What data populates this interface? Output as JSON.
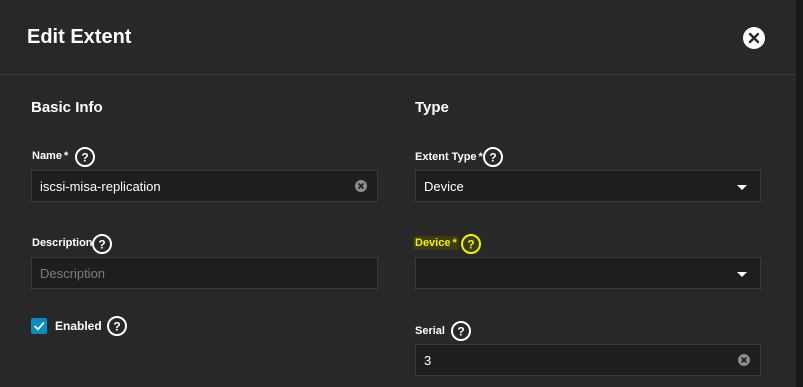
{
  "dialog": {
    "title": "Edit Extent"
  },
  "basic_info": {
    "section_title": "Basic Info",
    "name": {
      "label": "Name",
      "required_mark": "*",
      "value": "iscsi-misa-replication"
    },
    "description": {
      "label": "Description",
      "value": "",
      "placeholder": "Description"
    },
    "enabled": {
      "label": "Enabled",
      "checked": true
    }
  },
  "type": {
    "section_title": "Type",
    "extent_type": {
      "label": "Extent Type",
      "required_mark": "*",
      "value": "Device"
    },
    "device": {
      "label": "Device",
      "required_mark": "*",
      "value": ""
    },
    "serial": {
      "label": "Serial",
      "value": "3"
    }
  },
  "colors": {
    "panel_bg": "#282828",
    "input_bg": "#1e1e1e",
    "accent_checkbox": "#0a8bc4",
    "highlight_text": "#f2f200"
  },
  "icons": {
    "close": "close-icon",
    "help": "help-circle-icon",
    "clear": "clear-icon",
    "dropdown": "chevron-down-icon",
    "check": "check-icon"
  }
}
